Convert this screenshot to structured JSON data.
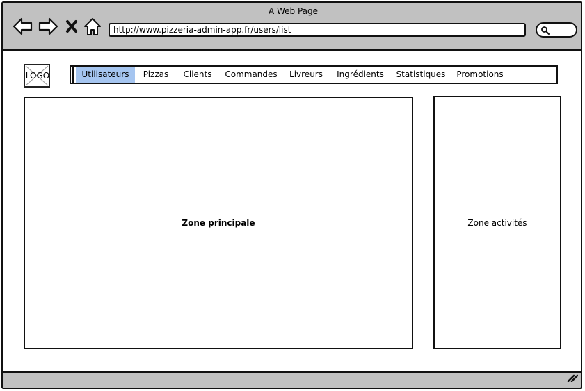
{
  "browser": {
    "window_title": "A Web Page",
    "url": "http://www.pizzeria-admin-app.fr/users/list"
  },
  "header": {
    "logo_text": "LOGO"
  },
  "nav": {
    "active_index": 0,
    "items": [
      {
        "label": "Utilisateurs"
      },
      {
        "label": "Pizzas"
      },
      {
        "label": "Clients"
      },
      {
        "label": "Commandes"
      },
      {
        "label": "Livreurs"
      },
      {
        "label": "Ingrédients"
      },
      {
        "label": "Statistiques"
      },
      {
        "label": "Promotions"
      }
    ]
  },
  "main": {
    "zone_principale": "Zone principale",
    "zone_activites": "Zone activités"
  },
  "colors": {
    "chrome": "#c1c1c1",
    "active_tab": "#a5c5f0"
  }
}
